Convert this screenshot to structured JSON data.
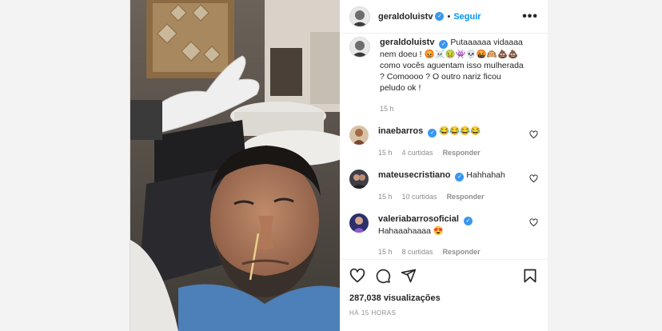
{
  "post": {
    "author": "geraldoluistv",
    "follow_label": "Seguir",
    "dot": "•",
    "more_label": "•••",
    "verified_mark": "✓"
  },
  "caption": {
    "user": "geraldoluistv",
    "text": "Putaaaaaa vidaaaa nem doeu ! 😡☠️🤢👾💀🤬🙉💩💩 como vocês aguentam isso mulherada ? Comoooo ? O outro nariz ficou peludo ok !",
    "time": "15 h"
  },
  "comments": [
    {
      "user": "inaebarros",
      "text": "😂😂😂😂",
      "time": "15 h",
      "likes": "4 curtidas",
      "reply": "Responder"
    },
    {
      "user": "mateusecristiano",
      "text": "Hahhahah",
      "time": "15 h",
      "likes": "10 curtidas",
      "reply": "Responder"
    },
    {
      "user": "valeriabarrosoficial",
      "text": "Hahaaahaaaa 😍",
      "time": "15 h",
      "likes": "8 curtidas",
      "reply": "Responder"
    }
  ],
  "stats": {
    "views": "287,038 visualizações",
    "ago": "HÁ 15 HORAS"
  },
  "icons": {
    "like": "heart-icon",
    "comment": "comment-icon",
    "share": "share-icon",
    "save": "bookmark-icon"
  },
  "colors": {
    "follow": "#0095f6",
    "verified": "#3897f0",
    "muted": "#8e8e8e"
  }
}
